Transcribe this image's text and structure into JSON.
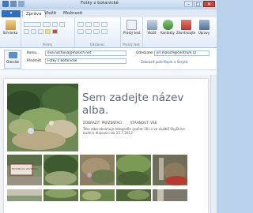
{
  "window": {
    "title": "Fotky z botanické",
    "buttons": {
      "minimize": "–",
      "maximize": "□",
      "close": "✕"
    }
  },
  "tabs": {
    "file": "",
    "items": [
      "Zpráva",
      "Vložit",
      "Možnosti"
    ]
  },
  "ribbon": {
    "groups": [
      {
        "name": "Schránka",
        "buttons": [
          "Schránka"
        ]
      },
      {
        "name": "Písmo",
        "buttons": []
      },
      {
        "name": "Odstavec",
        "buttons": []
      },
      {
        "name": "Prostý text",
        "buttons": [
          "Prostý text"
        ]
      },
      {
        "name": "",
        "buttons": [
          "Vložit",
          "Kontakty",
          "Zkontrolujte",
          "Úpravy"
        ]
      }
    ],
    "labels": {
      "clipboard": "Schránka",
      "font": "Písmo",
      "paragraph": "Odstavec",
      "plaintext": "Prostý text",
      "plaintext_group": "Prostý text",
      "insert": "Vložit",
      "contacts": "Kontakty",
      "spelling": "Zkontrolujte",
      "editing": "Úpravy"
    }
  },
  "compose": {
    "send_label": "Odeslat",
    "to_label": "Komu...",
    "to_value": "eva.nachova@masich.net",
    "from_label": "Odesílatel",
    "from_value": "jiri.masich@centrum.cz",
    "subject_label": "Předmět",
    "subject_value": "Fotky z botanické",
    "show_cc_bcc": "Zobrazit pole Kopie a Skrytá"
  },
  "album": {
    "title": "Sem zadejte název alba.",
    "links": [
      "ZOBRAZIT PREZENTACI",
      "STÁHNOUT VŠE"
    ],
    "description": "Tato alba obsahuje fotografie (počet 16) a ve službě SkyDrive bude k dispozici do 23.7.2012.",
    "sign_text": "BOTANICKÁ ZAHRADA"
  },
  "colors": {
    "accent": "#2f6fc2",
    "title_text": "#5a6b7d"
  }
}
